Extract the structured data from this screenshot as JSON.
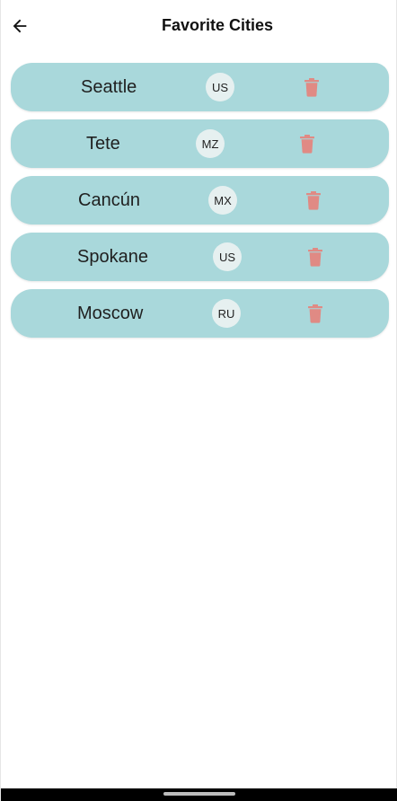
{
  "header": {
    "title": "Favorite Cities",
    "back_icon": "arrow-left-icon"
  },
  "colors": {
    "card": "#a9d8db",
    "badge": "#e6f0f0",
    "delete": "#e08a84"
  },
  "cities": [
    {
      "name": "Seattle",
      "country": "US"
    },
    {
      "name": "Tete",
      "country": "MZ"
    },
    {
      "name": "Cancún",
      "country": "MX"
    },
    {
      "name": "Spokane",
      "country": "US"
    },
    {
      "name": "Moscow",
      "country": "RU"
    }
  ],
  "delete_icon": "trash-icon"
}
